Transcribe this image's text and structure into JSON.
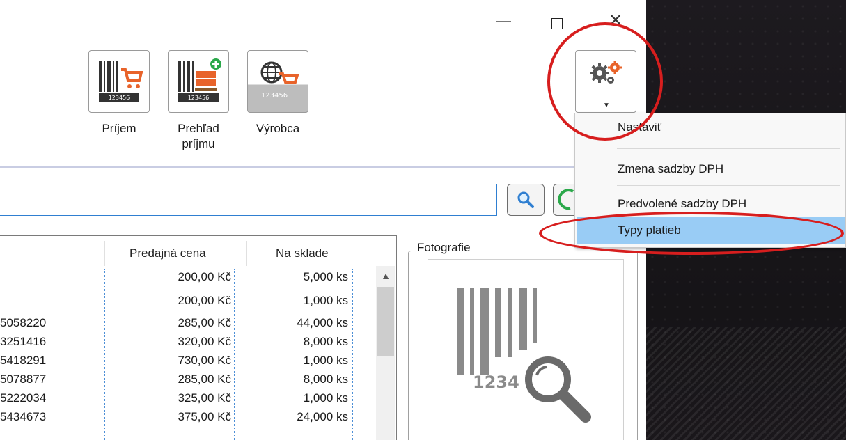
{
  "ribbon": {
    "buttons": [
      {
        "label": "Príjem",
        "icon": "barcode-cart-icon"
      },
      {
        "label": "Prehľad príjmu",
        "icon": "barcode-pallet-add-icon"
      },
      {
        "label": "Výrobca",
        "icon": "barcode-globe-cart-icon"
      }
    ],
    "prehlad_line1": "Prehľad",
    "prehlad_line2": "príjmu"
  },
  "table": {
    "headers": {
      "price": "Predajná cena",
      "stock": "Na sklade"
    },
    "rows": [
      {
        "code": "",
        "price": "200,00 Kč",
        "stock": "5,000 ks"
      },
      {
        "code": "",
        "price": "200,00 Kč",
        "stock": "1,000 ks"
      },
      {
        "code": "5058220",
        "price": "285,00 Kč",
        "stock": "44,000 ks"
      },
      {
        "code": "3251416",
        "price": "320,00 Kč",
        "stock": "8,000 ks"
      },
      {
        "code": "5418291",
        "price": "730,00 Kč",
        "stock": "1,000 ks"
      },
      {
        "code": "5078877",
        "price": "285,00 Kč",
        "stock": "8,000 ks"
      },
      {
        "code": "5222034",
        "price": "325,00 Kč",
        "stock": "1,000 ks"
      },
      {
        "code": "5434673",
        "price": "375,00 Kč",
        "stock": "24,000 ks"
      }
    ]
  },
  "photo": {
    "legend": "Fotografie",
    "placeholder_digits": "1234"
  },
  "menu": {
    "items": [
      "Nastaviť",
      "Zmena sadzby DPH",
      "Predvolené sadzby DPH",
      "Typy platieb"
    ],
    "highlighted_index": 3
  },
  "colors": {
    "accent_red": "#d71e1e",
    "menu_highlight": "#99ccf5",
    "icon_orange": "#e8632a"
  }
}
